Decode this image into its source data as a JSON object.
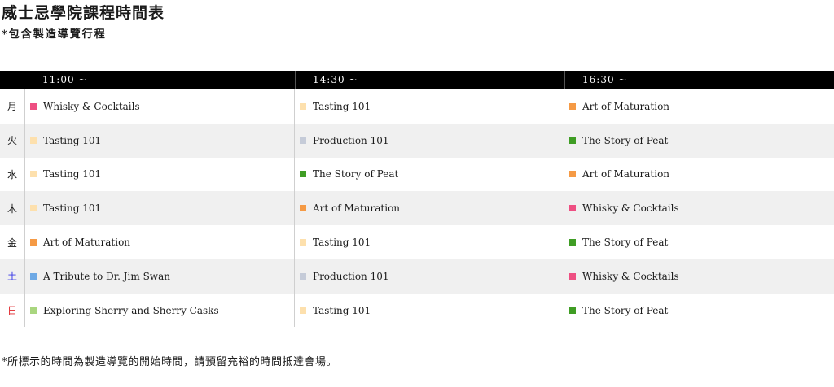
{
  "title": "威士忌學院課程時間表",
  "subtitle": "*包含製造導覽行程",
  "footnote": "*所標示的時間為製造導覽的開始時間，請預留充裕的時間抵達會場。",
  "time_slots": [
    "11:00 ~",
    "14:30 ~",
    "16:30 ~"
  ],
  "class_colors": {
    "Whisky & Cocktails": "#ee4f82",
    "Tasting 101": "#fde0ad",
    "Art of Maturation": "#f59a45",
    "Production 101": "#c5cbd8",
    "The Story of Peat": "#3f9d24",
    "A Tribute to Dr. Jim Swan": "#6ea9e5",
    "Exploring Sherry and Sherry Casks": "#a9d67f"
  },
  "days": [
    {
      "label": "月",
      "color": "#1a1a1a",
      "classes": [
        "Whisky & Cocktails",
        "Tasting 101",
        "Art of Maturation"
      ]
    },
    {
      "label": "火",
      "color": "#1a1a1a",
      "classes": [
        "Tasting 101",
        "Production 101",
        "The Story of Peat"
      ]
    },
    {
      "label": "水",
      "color": "#1a1a1a",
      "classes": [
        "Tasting 101",
        "The Story of Peat",
        "Art of Maturation"
      ]
    },
    {
      "label": "木",
      "color": "#1a1a1a",
      "classes": [
        "Tasting 101",
        "Art of Maturation",
        "Whisky & Cocktails"
      ]
    },
    {
      "label": "金",
      "color": "#1a1a1a",
      "classes": [
        "Art of Maturation",
        "Tasting 101",
        "The Story of Peat"
      ]
    },
    {
      "label": "土",
      "color": "#3737e6",
      "classes": [
        "A Tribute to Dr. Jim Swan",
        "Production 101",
        "Whisky & Cocktails"
      ]
    },
    {
      "label": "日",
      "color": "#e0262b",
      "classes": [
        "Exploring Sherry and Sherry Casks",
        "Tasting 101",
        "The Story of Peat"
      ]
    }
  ]
}
